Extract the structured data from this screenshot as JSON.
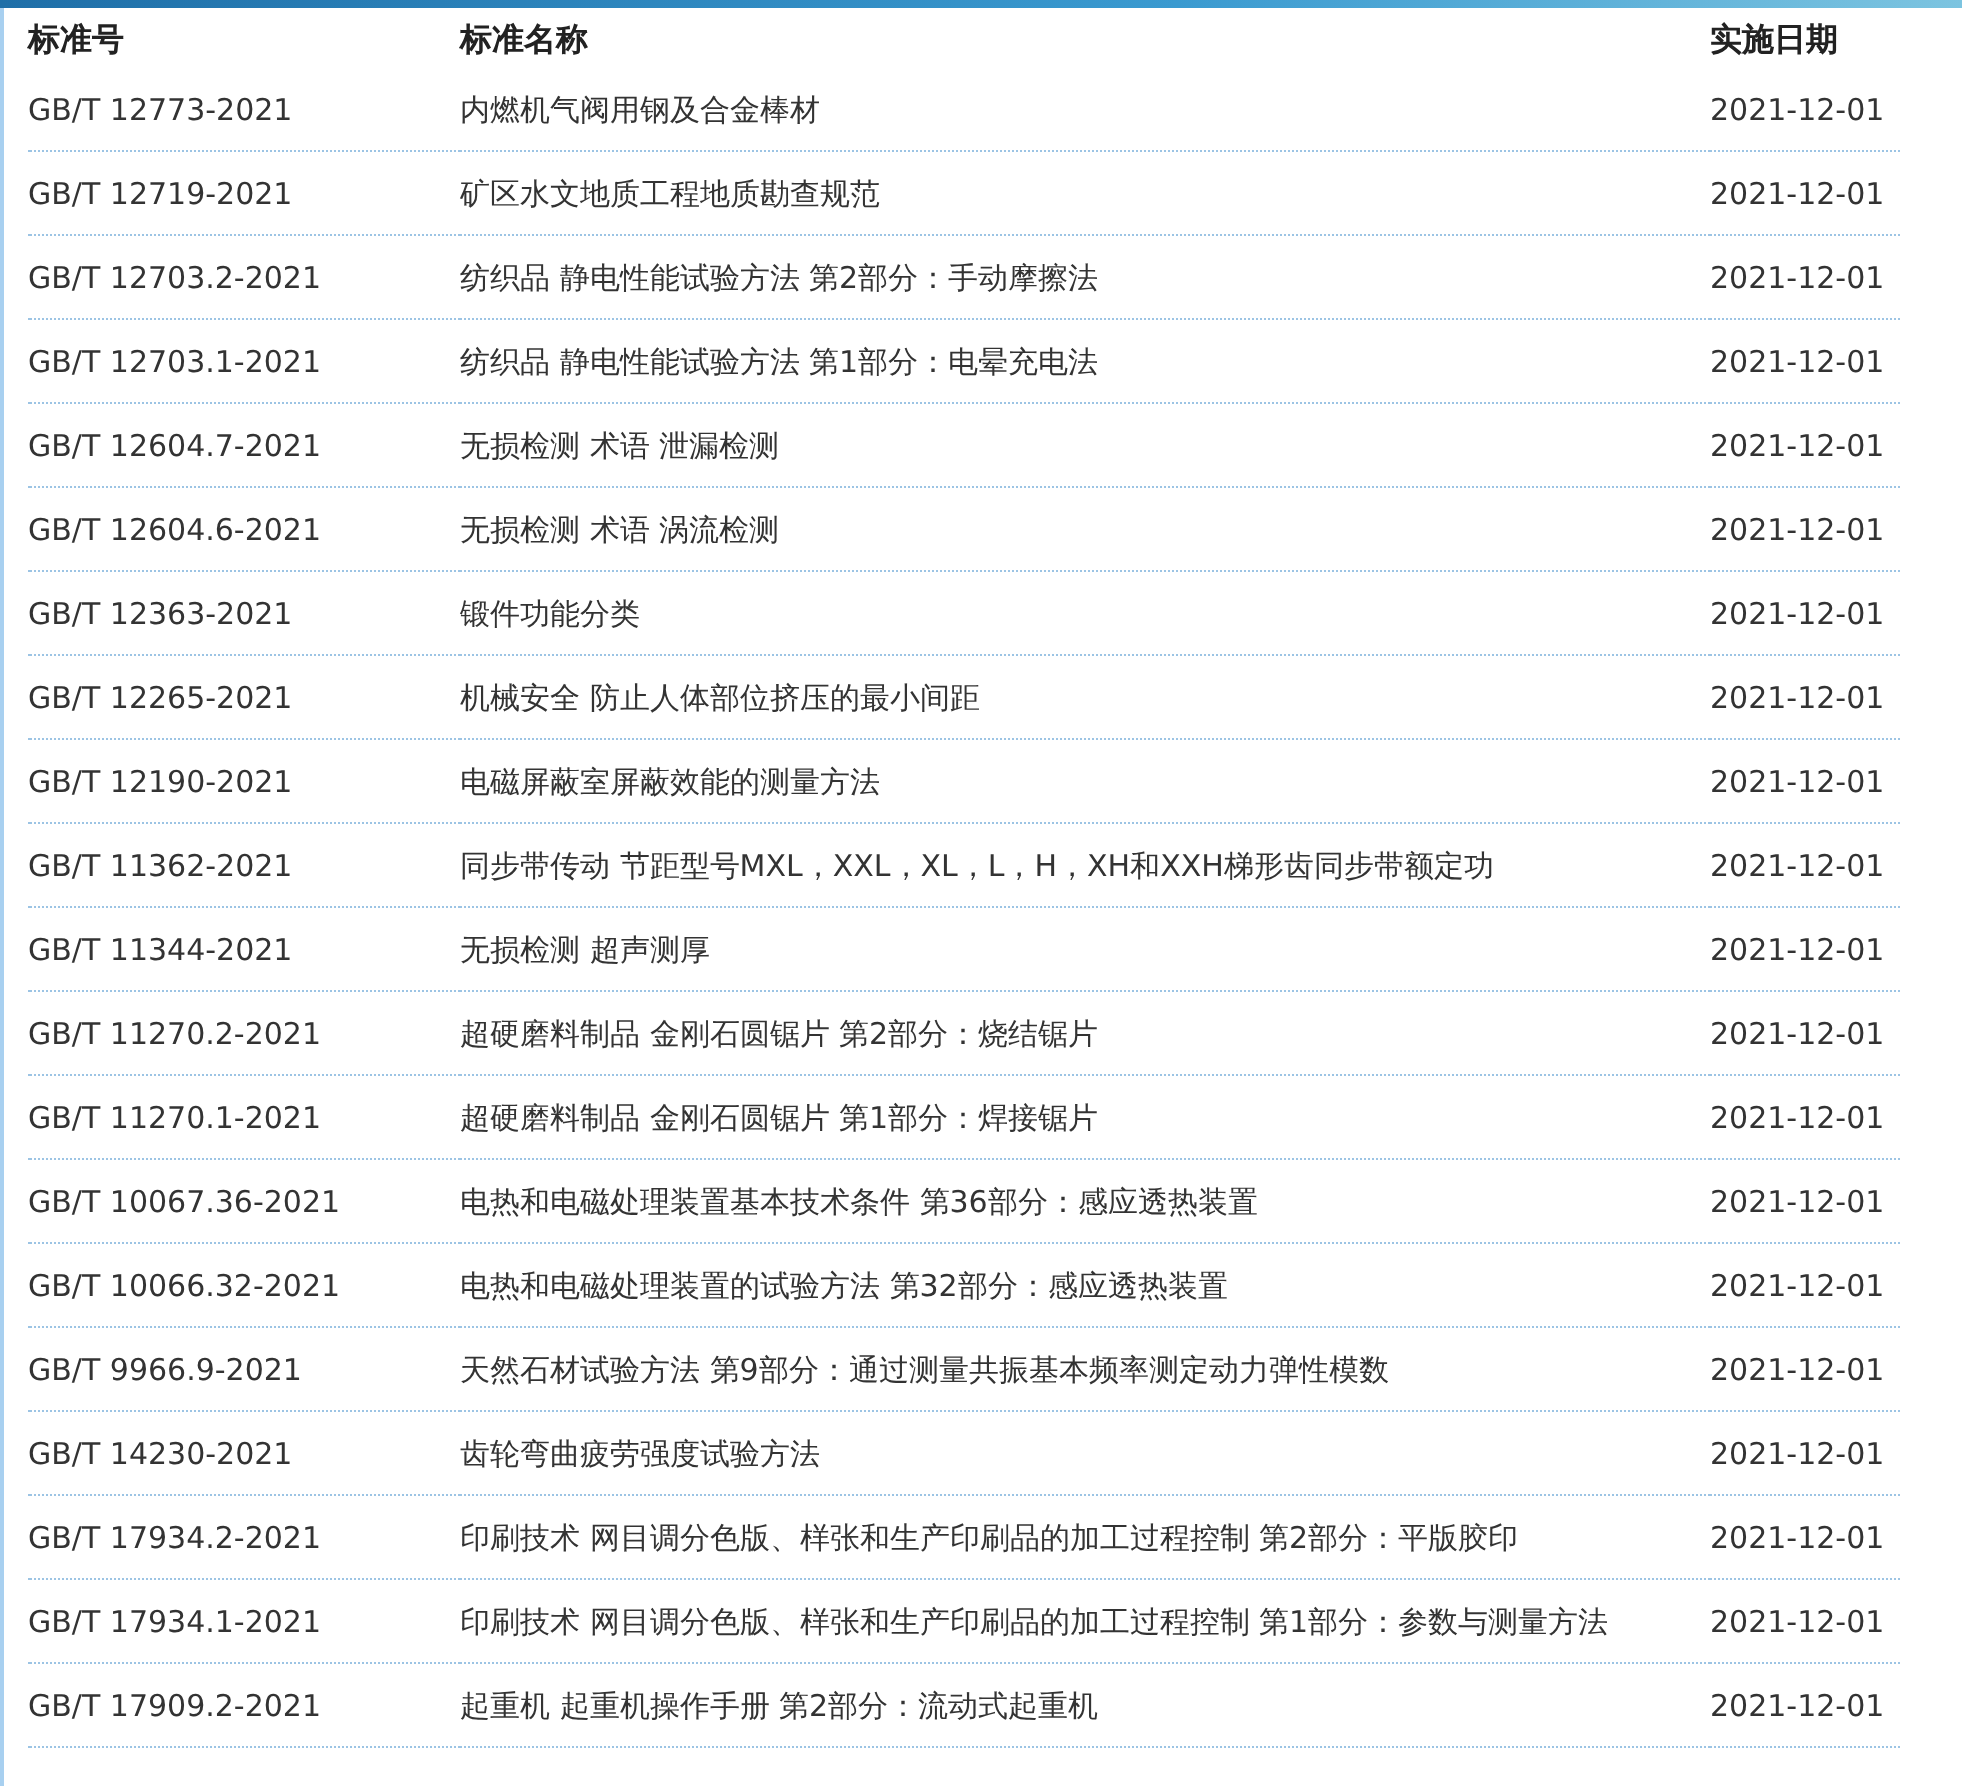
{
  "columns": [
    "标准号",
    "标准名称",
    "实施日期"
  ],
  "rows": [
    {
      "code": "GB/T 12773-2021",
      "name": "内燃机气阀用钢及合金棒材",
      "date": "2021-12-01"
    },
    {
      "code": "GB/T 12719-2021",
      "name": "矿区水文地质工程地质勘查规范",
      "date": "2021-12-01"
    },
    {
      "code": "GB/T 12703.2-2021",
      "name": "纺织品 静电性能试验方法 第2部分：手动摩擦法",
      "date": "2021-12-01"
    },
    {
      "code": "GB/T 12703.1-2021",
      "name": "纺织品 静电性能试验方法 第1部分：电晕充电法",
      "date": "2021-12-01"
    },
    {
      "code": "GB/T 12604.7-2021",
      "name": "无损检测 术语 泄漏检测",
      "date": "2021-12-01"
    },
    {
      "code": "GB/T 12604.6-2021",
      "name": "无损检测 术语 涡流检测",
      "date": "2021-12-01"
    },
    {
      "code": "GB/T 12363-2021",
      "name": "锻件功能分类",
      "date": "2021-12-01"
    },
    {
      "code": "GB/T 12265-2021",
      "name": "机械安全 防止人体部位挤压的最小间距",
      "date": "2021-12-01"
    },
    {
      "code": "GB/T 12190-2021",
      "name": "电磁屏蔽室屏蔽效能的测量方法",
      "date": "2021-12-01"
    },
    {
      "code": "GB/T 11362-2021",
      "name": "同步带传动 节距型号MXL，XXL，XL，L，H，XH和XXH梯形齿同步带额定功",
      "date": "2021-12-01"
    },
    {
      "code": "GB/T 11344-2021",
      "name": "无损检测 超声测厚",
      "date": "2021-12-01"
    },
    {
      "code": "GB/T 11270.2-2021",
      "name": "超硬磨料制品 金刚石圆锯片 第2部分：烧结锯片",
      "date": "2021-12-01"
    },
    {
      "code": "GB/T 11270.1-2021",
      "name": "超硬磨料制品 金刚石圆锯片 第1部分：焊接锯片",
      "date": "2021-12-01"
    },
    {
      "code": "GB/T 10067.36-2021",
      "name": "电热和电磁处理装置基本技术条件 第36部分：感应透热装置",
      "date": "2021-12-01"
    },
    {
      "code": "GB/T 10066.32-2021",
      "name": "电热和电磁处理装置的试验方法 第32部分：感应透热装置",
      "date": "2021-12-01"
    },
    {
      "code": "GB/T 9966.9-2021",
      "name": "天然石材试验方法 第9部分：通过测量共振基本频率测定动力弹性模数",
      "date": "2021-12-01"
    },
    {
      "code": "GB/T 14230-2021",
      "name": "齿轮弯曲疲劳强度试验方法",
      "date": "2021-12-01"
    },
    {
      "code": "GB/T 17934.2-2021",
      "name": "印刷技术 网目调分色版、样张和生产印刷品的加工过程控制 第2部分：平版胶印",
      "date": "2021-12-01"
    },
    {
      "code": "GB/T 17934.1-2021",
      "name": "印刷技术 网目调分色版、样张和生产印刷品的加工过程控制 第1部分：参数与测量方法",
      "date": "2021-12-01"
    },
    {
      "code": "GB/T 17909.2-2021",
      "name": "起重机 起重机操作手册 第2部分：流动式起重机",
      "date": "2021-12-01"
    }
  ]
}
